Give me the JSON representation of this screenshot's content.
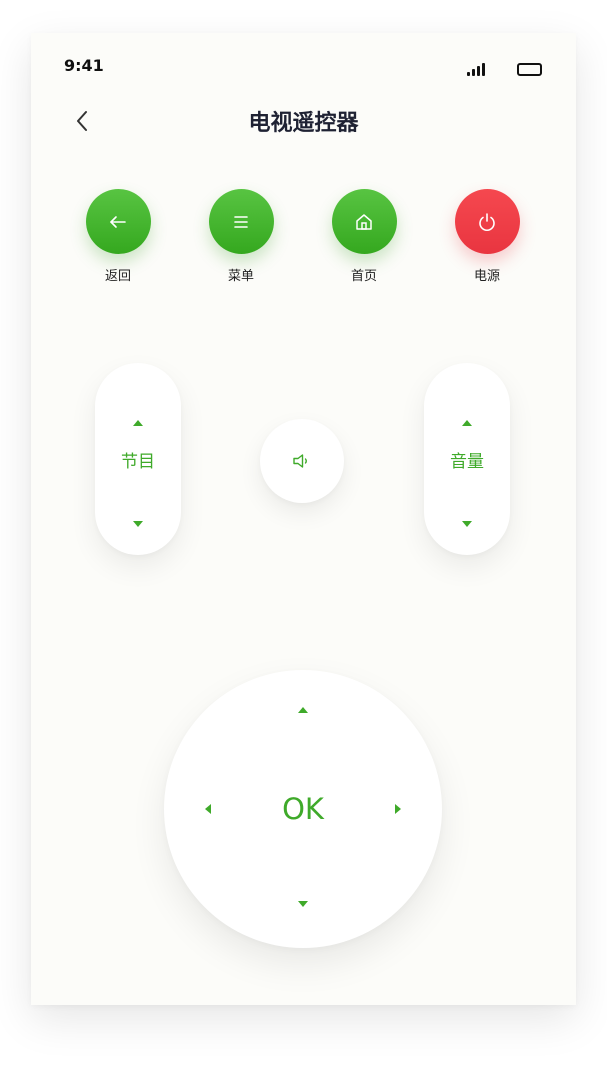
{
  "status_bar": {
    "time": "9:41"
  },
  "header": {
    "title": "电视遥控器"
  },
  "top_buttons": [
    {
      "label": "返回",
      "icon": "arrow-left-icon",
      "color": "#3faa2a"
    },
    {
      "label": "菜单",
      "icon": "menu-icon",
      "color": "#3faa2a"
    },
    {
      "label": "首页",
      "icon": "home-icon",
      "color": "#3faa2a"
    },
    {
      "label": "电源",
      "icon": "power-icon",
      "color": "#ea3b45"
    }
  ],
  "channel": {
    "label": "节目"
  },
  "volume": {
    "label": "音量"
  },
  "mute": {
    "icon": "speaker-icon"
  },
  "dpad": {
    "center_label": "OK"
  },
  "colors": {
    "accent": "#3faa2a",
    "danger": "#ea3b45",
    "background": "#fcfcf9"
  }
}
